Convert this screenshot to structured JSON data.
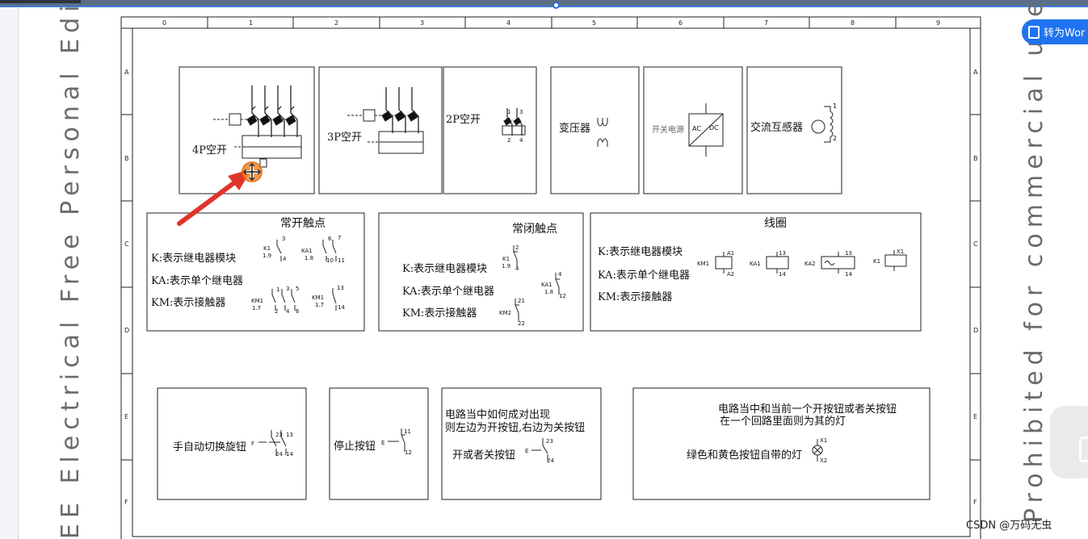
{
  "watermarks": {
    "left": "EE Electrical Free Personal Edition",
    "right": "Prohibited for commercial use"
  },
  "toolbar": {
    "convert_button": "转为Wor"
  },
  "footer": {
    "credit": "CSDN @万码无虫"
  },
  "frame": {
    "columns": [
      "0",
      "1",
      "2",
      "3",
      "4",
      "5",
      "6",
      "7",
      "8",
      "9"
    ],
    "rows": [
      "A",
      "B",
      "C",
      "D",
      "E",
      "F"
    ]
  },
  "symbols": {
    "breaker_4p": "4P空开",
    "breaker_3p": "3P空开",
    "breaker_2p": "2P空开",
    "transformer": "变压器",
    "switch_psu": "开关电源",
    "psu_ac": "AC",
    "psu_dc": "DC",
    "current_transformer": "交流互感器",
    "ct_pin1": "1",
    "ct_pin2": "2",
    "pin_1": "1",
    "pin_3": "3",
    "pin_2": "2",
    "pin_4": "4"
  },
  "no_contacts": {
    "title": "常开触点",
    "k_desc": "K:表示继电器模块",
    "ka_desc": "KA:表示单个继电器",
    "km_desc": "KM:表示接触器",
    "k1": "K1",
    "k1_ref": "1.9",
    "ka1": "KA1",
    "ka1_ref": "1.8",
    "km1": "KM1",
    "km1_ref": "1.7",
    "n3": "3",
    "n4": "4",
    "n6": "6",
    "n7": "7",
    "n10": "10",
    "n11": "11",
    "n1": "1",
    "n2": "2",
    "n5": "5",
    "n13": "13",
    "n14": "14"
  },
  "nc_contacts": {
    "title": "常闭触点",
    "k_desc": "K:表示继电器模块",
    "ka_desc": "KA:表示单个继电器",
    "km_desc": "KM:表示接触器",
    "k1": "K1",
    "k1_ref": "1.9",
    "ka1": "KA1",
    "ka1_ref": "1.8",
    "km2": "KM2",
    "n2": "2",
    "n4": "4",
    "n12": "12",
    "n21": "21",
    "n22": "22"
  },
  "coils": {
    "title": "线圈",
    "k_desc": "K:表示继电器模块",
    "ka_desc": "KA:表示单个继电器",
    "km_desc": "KM:表示接触器",
    "km1": "KM1",
    "a1": "A1",
    "a2": "A2",
    "ka1": "KA1",
    "ka2": "KA2",
    "n13": "13",
    "n14": "14",
    "k1": "K1",
    "x1": "X1"
  },
  "buttons": {
    "selector": "手自动切换旋钮",
    "selector_prefix": "F",
    "n23": "23",
    "n13": "13",
    "n24": "24",
    "n14": "14",
    "stop": "停止按钮",
    "stop_prefix": "E",
    "n11": "11",
    "n12": "12",
    "pair_line1": "电路当中如何成对出现",
    "pair_line2": "则左边为开按钮,右边为关按钮",
    "on_off": "开或者关按钮",
    "lamp_line1": "电路当中和当前一个开按钮或者关按钮",
    "lamp_line2": "在一个回路里面则为其的灯",
    "lamp_desc": "绿色和黄色按钮自带的灯",
    "x1": "X1",
    "x2": "X2"
  }
}
